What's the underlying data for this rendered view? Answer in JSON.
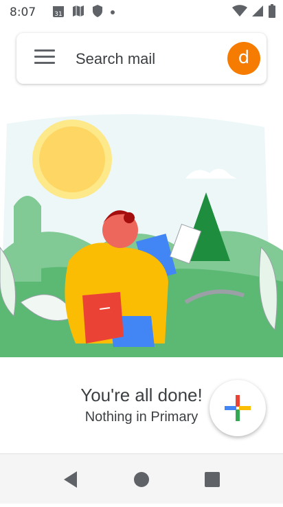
{
  "status_bar": {
    "time": "8:07",
    "notification_icons": [
      "calendar-icon",
      "maps-icon",
      "shield-icon",
      "dot-icon"
    ],
    "calendar_day": "31",
    "system_icons": [
      "wifi-icon",
      "signal-icon",
      "battery-icon"
    ]
  },
  "search": {
    "placeholder": "Search mail",
    "avatar_letter": "d",
    "avatar_color": "#f57c00"
  },
  "empty_state": {
    "title": "You're all done!",
    "subtitle": "Nothing in Primary"
  },
  "fab": {
    "icon": "compose-plus-icon"
  },
  "nav_bar": {
    "buttons": [
      "back-icon",
      "home-icon",
      "recents-icon"
    ]
  }
}
